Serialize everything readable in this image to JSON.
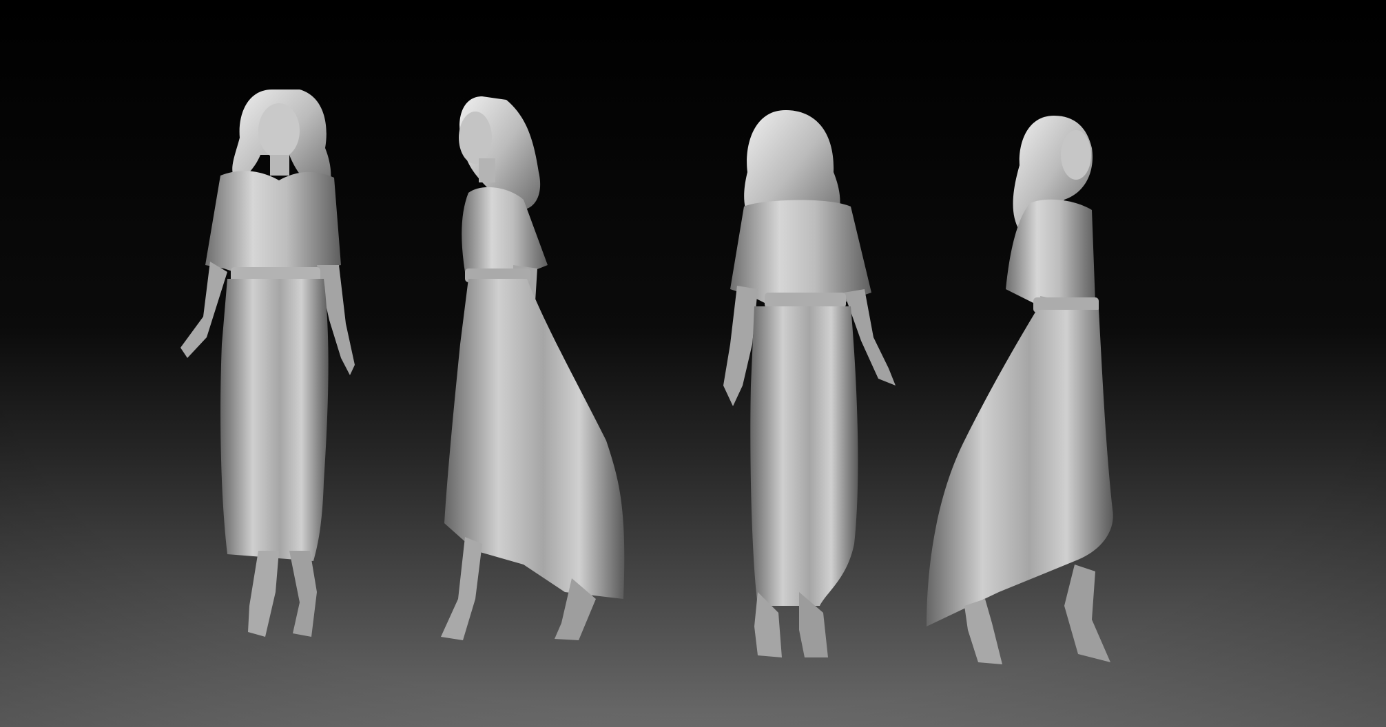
{
  "scene": {
    "background_top_color": "#000000",
    "background_bottom_color": "#6a6a6a",
    "clay_light_color": "#e2e2e2",
    "clay_mid_color": "#a9a9a9",
    "clay_dark_color": "#5c5c5c",
    "figures": [
      {
        "view": "front",
        "icon": "sculpt-figure-front-icon"
      },
      {
        "view": "side-left",
        "icon": "sculpt-figure-side-icon"
      },
      {
        "view": "back",
        "icon": "sculpt-figure-back-icon"
      },
      {
        "view": "side-right",
        "icon": "sculpt-figure-side-icon"
      }
    ]
  }
}
